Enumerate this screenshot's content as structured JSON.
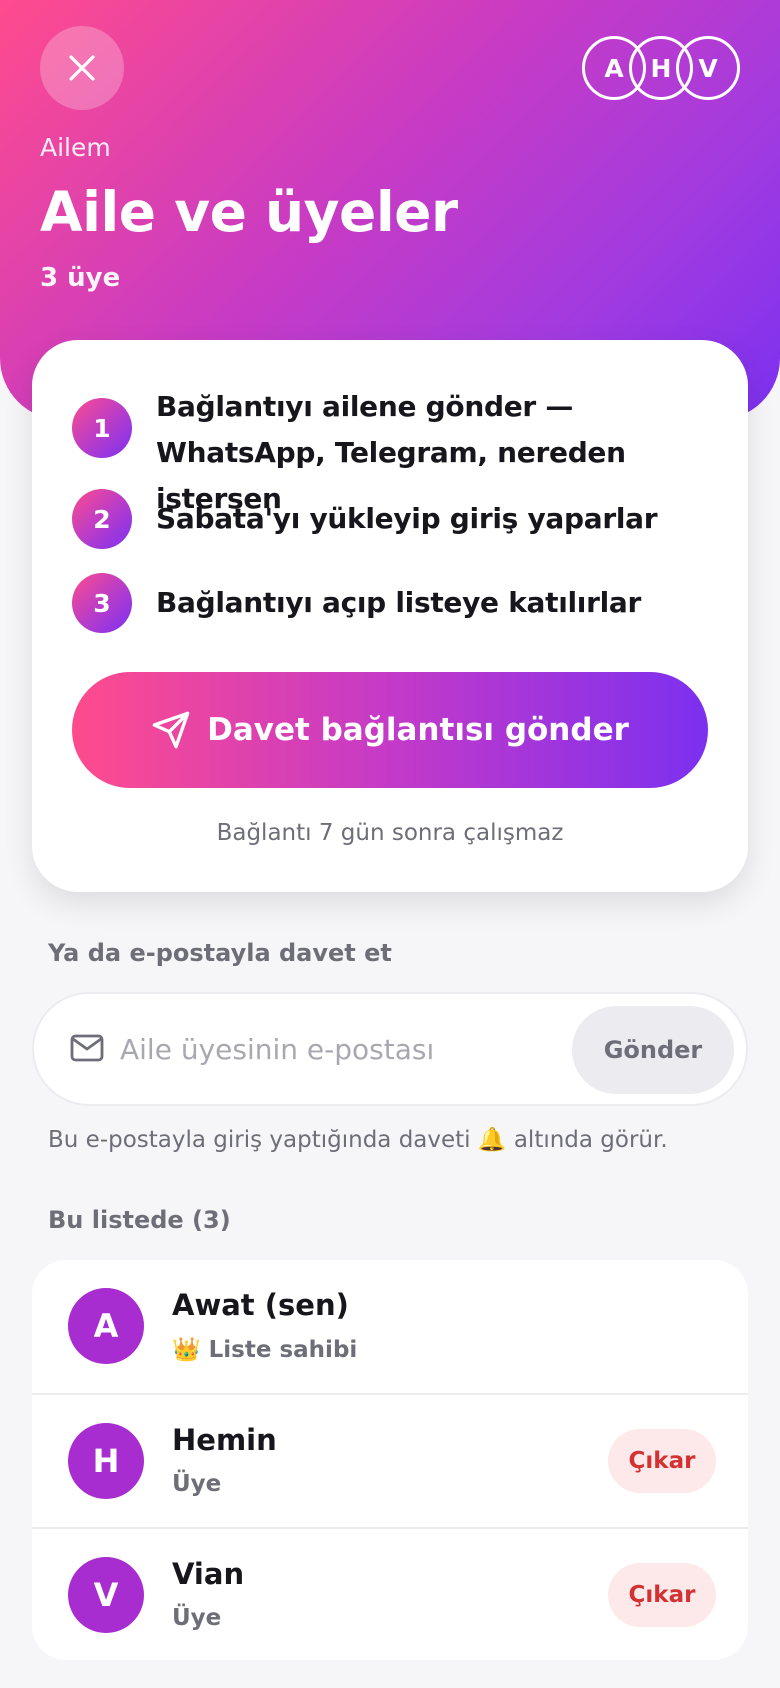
{
  "header": {
    "eyebrow": "Ailem",
    "title": "Aile ve üyeler",
    "member_count": "3 üye",
    "avatars": [
      "A",
      "H",
      "V"
    ]
  },
  "invite": {
    "steps": [
      {
        "num": "1",
        "text": "Bağlantıyı ailene gönder — WhatsApp, Telegram, nereden istersen"
      },
      {
        "num": "2",
        "text": "Sabata'yı yükleyip giriş yaparlar"
      },
      {
        "num": "3",
        "text": "Bağlantıyı açıp listeye katılırlar"
      }
    ],
    "button_label": "Davet bağlantısı gönder",
    "expiry_note": "Bağlantı 7 gün sonra çalışmaz"
  },
  "email_invite": {
    "section_label": "Ya da e-postayla davet et",
    "placeholder": "Aile üyesinin e-postası",
    "value": "",
    "send_label": "Gönder",
    "hint": "Bu e-postayla giriş yaptığında daveti 🔔 altında görür."
  },
  "members": {
    "section_label": "Bu listede (3)",
    "items": [
      {
        "initial": "A",
        "name": "Awat (sen)",
        "role": "👑 Liste sahibi",
        "action": ""
      },
      {
        "initial": "H",
        "name": "Hemin",
        "role": "Üye",
        "action": "Çıkar"
      },
      {
        "initial": "V",
        "name": "Vian",
        "role": "Üye",
        "action": "Çıkar"
      }
    ]
  },
  "colors": {
    "gradient_start": "#ff4b8d",
    "gradient_end": "#7c30f0",
    "avatar": "#a82dd0",
    "danger": "#d33232",
    "danger_bg": "#fde9e9"
  },
  "icons": {
    "close": "close-icon",
    "send": "send-icon",
    "mail": "mail-icon"
  }
}
